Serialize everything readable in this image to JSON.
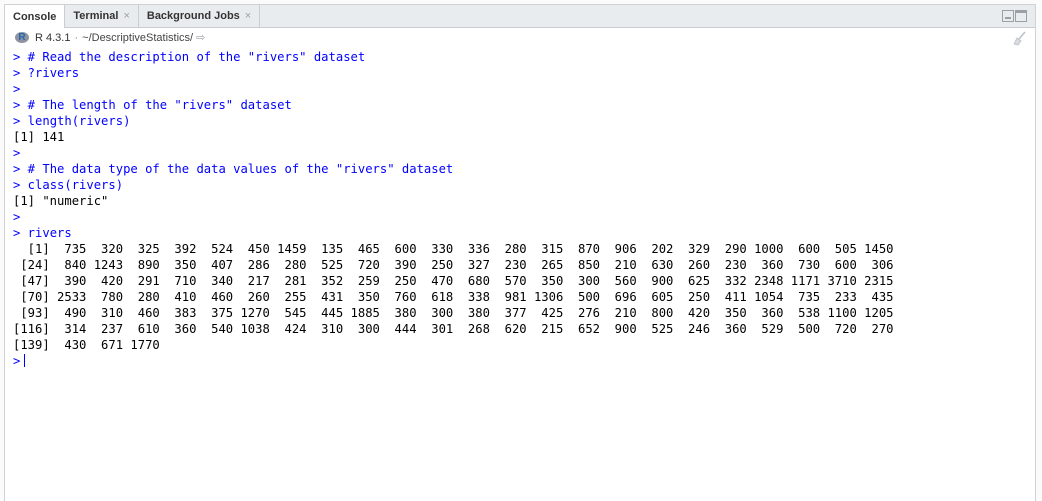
{
  "tabs": [
    {
      "label": "Console",
      "closable": false
    },
    {
      "label": "Terminal",
      "closable": true
    },
    {
      "label": "Background Jobs",
      "closable": true
    }
  ],
  "info": {
    "r_version": "R 4.3.1",
    "separator": "·",
    "working_dir": "~/DescriptiveStatistics/"
  },
  "console_lines": [
    {
      "kind": "input",
      "prompt": ">",
      "text": "# Read the description of the \"rivers\" dataset"
    },
    {
      "kind": "input",
      "prompt": ">",
      "text": "?rivers"
    },
    {
      "kind": "input",
      "prompt": ">",
      "text": ""
    },
    {
      "kind": "input",
      "prompt": ">",
      "text": "# The length of the \"rivers\" dataset"
    },
    {
      "kind": "input",
      "prompt": ">",
      "text": "length(rivers)"
    },
    {
      "kind": "output",
      "text": "[1] 141"
    },
    {
      "kind": "input",
      "prompt": ">",
      "text": ""
    },
    {
      "kind": "input",
      "prompt": ">",
      "text": "# The data type of the data values of the \"rivers\" dataset"
    },
    {
      "kind": "input",
      "prompt": ">",
      "text": "class(rivers)"
    },
    {
      "kind": "output",
      "text": "[1] \"numeric\""
    },
    {
      "kind": "input",
      "prompt": ">",
      "text": ""
    },
    {
      "kind": "input",
      "prompt": ">",
      "text": "rivers"
    },
    {
      "kind": "output",
      "text": "  [1]  735  320  325  392  524  450 1459  135  465  600  330  336  280  315  870  906  202  329  290 1000  600  505 1450"
    },
    {
      "kind": "output",
      "text": " [24]  840 1243  890  350  407  286  280  525  720  390  250  327  230  265  850  210  630  260  230  360  730  600  306"
    },
    {
      "kind": "output",
      "text": " [47]  390  420  291  710  340  217  281  352  259  250  470  680  570  350  300  560  900  625  332 2348 1171 3710 2315"
    },
    {
      "kind": "output",
      "text": " [70] 2533  780  280  410  460  260  255  431  350  760  618  338  981 1306  500  696  605  250  411 1054  735  233  435"
    },
    {
      "kind": "output",
      "text": " [93]  490  310  460  383  375 1270  545  445 1885  380  300  380  377  425  276  210  800  420  350  360  538 1100 1205"
    },
    {
      "kind": "output",
      "text": "[116]  314  237  610  360  540 1038  424  310  300  444  301  268  620  215  652  900  525  246  360  529  500  720  270"
    },
    {
      "kind": "output",
      "text": "[139]  430  671 1770"
    },
    {
      "kind": "cursor",
      "prompt": ">",
      "text": ""
    }
  ]
}
